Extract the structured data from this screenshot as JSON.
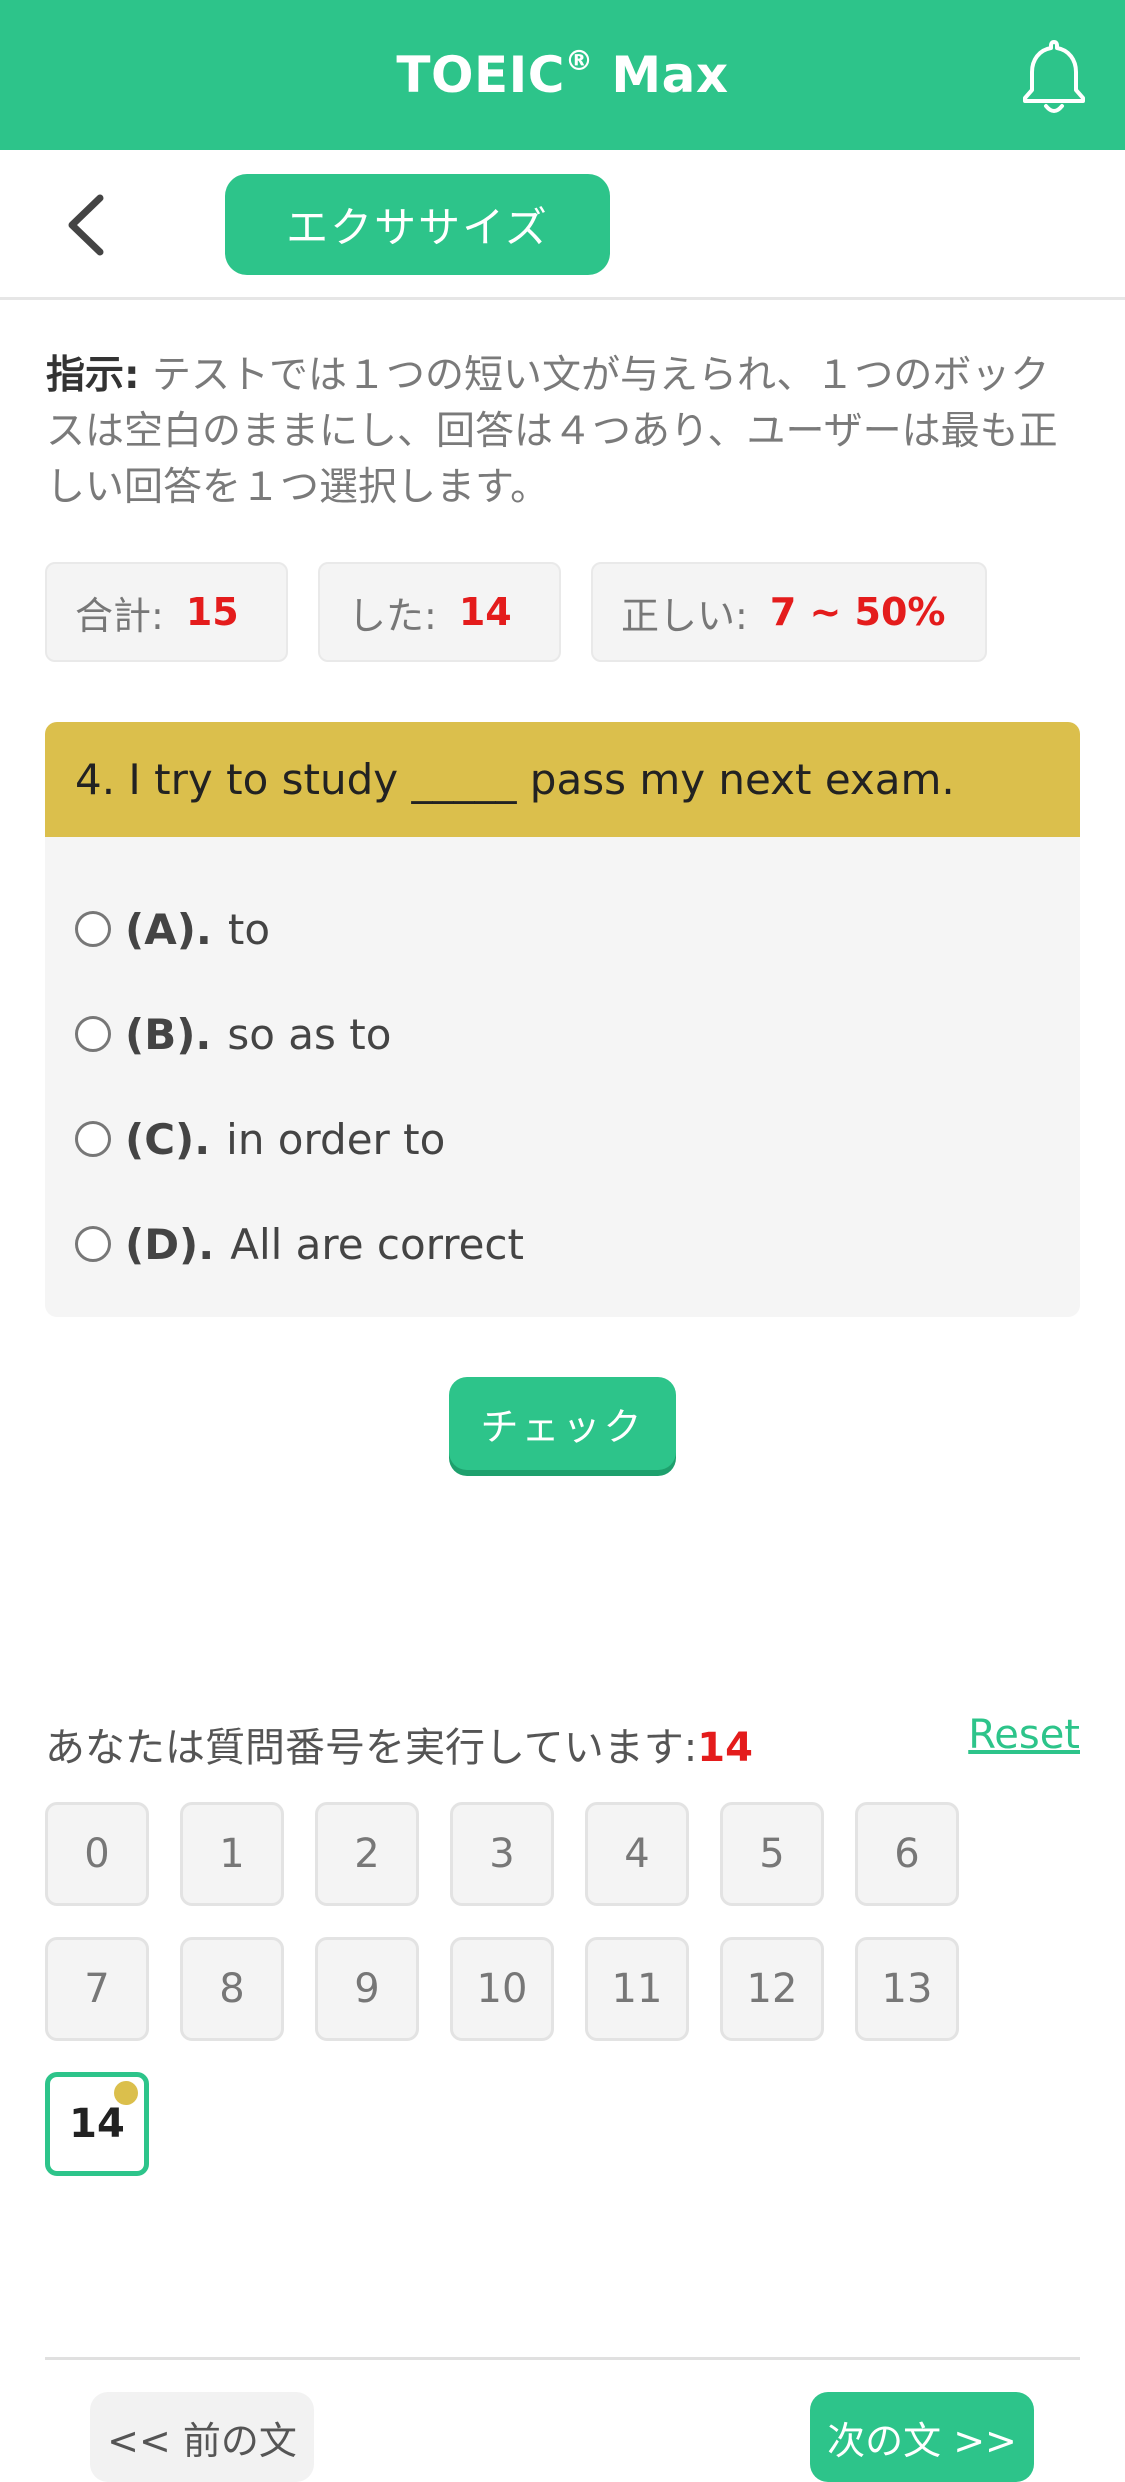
{
  "header": {
    "title_main": "TOEIC",
    "title_reg": "®",
    "title_suffix": " Max",
    "bell_icon": "bell-icon"
  },
  "subheader": {
    "back_icon": "chevron-left-icon",
    "tab_label": "エクササイズ"
  },
  "instruction": {
    "label": "指示:",
    "text": " テストでは１つの短い文が与えられ、１つのボックスは空白のままにし、回答は４つあり、ユーザーは最も正しい回答を１つ選択します。"
  },
  "stats": {
    "total_label": "合計:",
    "total_value": "15",
    "done_label": "した:",
    "done_value": "14",
    "correct_label": "正しい:",
    "correct_value": "7 ~ 50%"
  },
  "question": {
    "text": "4. I try to study _____ pass my next exam.",
    "options": [
      {
        "label": "(A).",
        "text": "to"
      },
      {
        "label": "(B).",
        "text": "so as to"
      },
      {
        "label": "(C).",
        "text": "in order to"
      },
      {
        "label": "(D).",
        "text": "All are correct"
      }
    ]
  },
  "check_label": "チェック",
  "progress": {
    "running_label": "あなたは質問番号を実行しています:",
    "running_number": "14",
    "reset_label": "Reset",
    "cells": [
      "0",
      "1",
      "2",
      "3",
      "4",
      "5",
      "6",
      "7",
      "8",
      "9",
      "10",
      "11",
      "12",
      "13",
      "14"
    ],
    "active_index": 14
  },
  "footer": {
    "prev_label": "<< 前の文",
    "next_label": "次の文 >>"
  },
  "colors": {
    "brand": "#2dc48a",
    "question_header": "#dbbf4c",
    "highlight_red": "#e41c1c"
  }
}
